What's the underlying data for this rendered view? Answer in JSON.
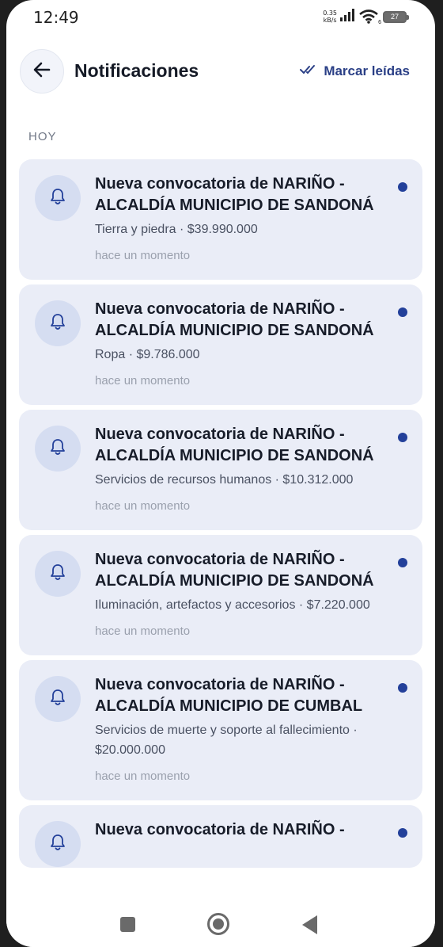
{
  "status_bar": {
    "time": "12:49",
    "net_speed_value": "0.35",
    "net_speed_unit": "kB/s",
    "wifi_badge": "6",
    "battery_level": "27"
  },
  "header": {
    "title": "Notificaciones",
    "mark_read_label": "Marcar leídas"
  },
  "section": {
    "label": "HOY"
  },
  "notifications": [
    {
      "title": "Nueva convocatoria de NARIÑO - ALCALDÍA MUNICIPIO DE SANDONÁ",
      "detail": "Tierra y piedra · $39.990.000",
      "time": "hace un momento",
      "unread": true
    },
    {
      "title": "Nueva convocatoria de NARIÑO - ALCALDÍA MUNICIPIO DE SANDONÁ",
      "detail": "Ropa · $9.786.000",
      "time": "hace un momento",
      "unread": true
    },
    {
      "title": "Nueva convocatoria de NARIÑO - ALCALDÍA MUNICIPIO DE SANDONÁ",
      "detail": "Servicios de recursos humanos · $10.312.000",
      "time": "hace un momento",
      "unread": true
    },
    {
      "title": "Nueva convocatoria de NARIÑO - ALCALDÍA MUNICIPIO DE SANDONÁ",
      "detail": "Iluminación, artefactos y accesorios · $7.220.000",
      "time": "hace un momento",
      "unread": true
    },
    {
      "title": "Nueva convocatoria de NARIÑO - ALCALDÍA MUNICIPIO DE CUMBAL",
      "detail": "Servicios de muerte y soporte al fallecimiento · $20.000.000",
      "time": "hace un momento",
      "unread": true
    },
    {
      "title": "Nueva convocatoria de NARIÑO -",
      "detail": "",
      "time": "",
      "unread": true
    }
  ],
  "icons": {
    "back": "arrow-left-icon",
    "mark_read": "double-check-icon",
    "notification": "bell-icon",
    "nav_recent": "square-icon",
    "nav_home": "circle-icon",
    "nav_back": "triangle-back-icon"
  },
  "colors": {
    "accent": "#2a3f86",
    "unread_dot": "#23409a",
    "card_background": "#eaedf7",
    "bell_circle": "#d5ddf1"
  }
}
